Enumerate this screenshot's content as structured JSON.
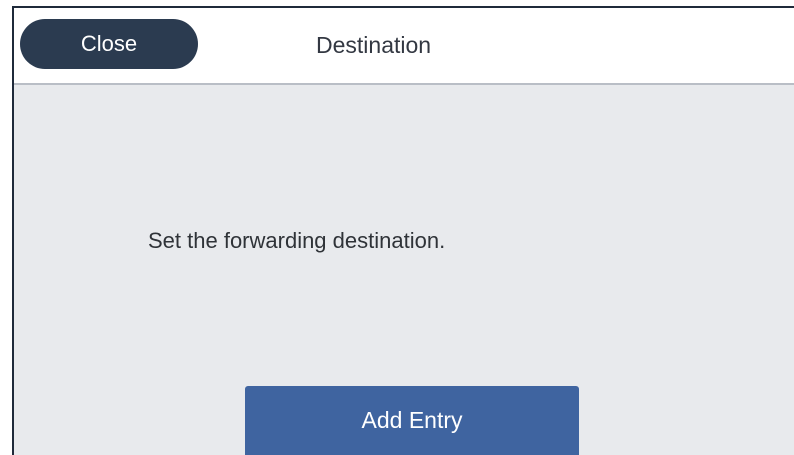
{
  "header": {
    "close_label": "Close",
    "title": "Destination"
  },
  "main": {
    "message": "Set the forwarding destination.",
    "add_entry_label": "Add Entry"
  },
  "colors": {
    "header_bg": "#ffffff",
    "body_bg": "#e8eaed",
    "close_button": "#2b3b50",
    "add_entry_button": "#3f64a0"
  }
}
